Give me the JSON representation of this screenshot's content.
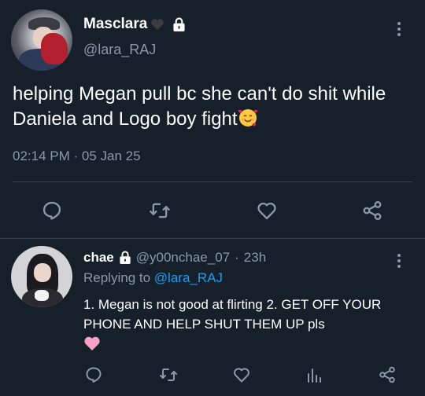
{
  "tweet": {
    "display_name": "Masclara",
    "handle": "@lara_RAJ",
    "text": "helping Megan pull bc she can't do shit while Daniela and Logo boy fight",
    "emoji": "smiling-face-with-hearts",
    "time": "02:14 PM",
    "separator": "·",
    "date": "05 Jan 25",
    "icons": [
      "black-heart-icon",
      "lock-icon",
      "more-icon",
      "reply-icon",
      "retweet-icon",
      "like-icon",
      "share-icon"
    ]
  },
  "reply": {
    "display_name": "chae",
    "handle": "@y00nchae_07",
    "separator": "·",
    "age": "23h",
    "replying_label": "Replying to",
    "replying_handle": "@lara_RAJ",
    "text": "1. Megan is not good at flirting 2. GET OFF YOUR PHONE AND HELP SHUT THEM UP pls",
    "emoji": "pink-heart",
    "icons": [
      "lock-icon",
      "more-icon",
      "reply-icon",
      "retweet-icon",
      "like-icon",
      "analytics-icon",
      "share-icon"
    ]
  },
  "colors": {
    "background": "#15202b",
    "text": "#ffffff",
    "muted": "#8b98a5",
    "link": "#1d9bf0",
    "divider": "#38444d"
  }
}
